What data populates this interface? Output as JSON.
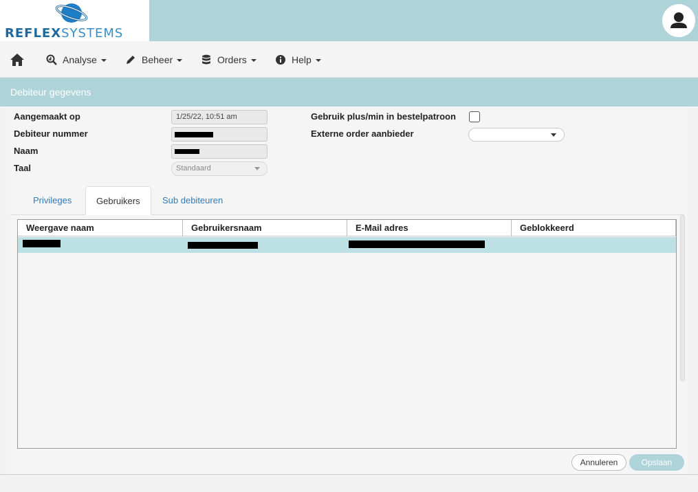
{
  "header": {
    "logo_left": "REFLEX",
    "logo_right": "SYSTEMS"
  },
  "nav": {
    "home_icon": "home-icon",
    "items": [
      {
        "label": "Analyse",
        "icon": "search-chart-icon"
      },
      {
        "label": "Beheer",
        "icon": "pencil-icon"
      },
      {
        "label": "Orders",
        "icon": "database-icon"
      },
      {
        "label": "Help",
        "icon": "info-icon"
      }
    ]
  },
  "section": {
    "title": "Debiteur gegevens"
  },
  "form": {
    "created_label": "Aangemaakt op",
    "created_value": "1/25/22, 10:51 am",
    "debtor_number_label": "Debiteur nummer",
    "name_label": "Naam",
    "language_label": "Taal",
    "language_value": "Standaard",
    "plusmin_label": "Gebruik plus/min in bestelpatroon",
    "plusmin_checked": false,
    "external_label": "Externe order aanbieder",
    "external_value": ""
  },
  "tabs": [
    {
      "label": "Privileges",
      "active": false
    },
    {
      "label": "Gebruikers",
      "active": true
    },
    {
      "label": "Sub debiteuren",
      "active": false
    }
  ],
  "grid": {
    "columns": [
      "Weergave naam",
      "Gebruikersnaam",
      "E-Mail adres",
      "Geblokkeerd"
    ],
    "rows": [
      {
        "selected": true
      }
    ]
  },
  "buttons": {
    "cancel": "Annuleren",
    "save": "Opslaan"
  },
  "colors": {
    "accent": "#aed3d9",
    "link": "#337ab7",
    "selected_row": "#bde0e4"
  }
}
